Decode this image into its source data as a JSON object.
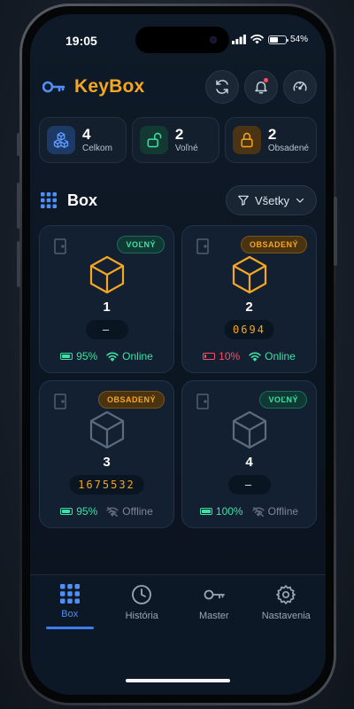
{
  "status_bar": {
    "time": "19:05",
    "battery": "54%",
    "battery_level": 0.54
  },
  "header": {
    "title": "KeyBox",
    "buttons": [
      "refresh-icon",
      "bell-icon",
      "gauge-icon"
    ],
    "has_notification": true
  },
  "stats": [
    {
      "value": "4",
      "label": "Celkom",
      "icon": "cubes-icon",
      "color": "#4f8ff7"
    },
    {
      "value": "2",
      "label": "Voľné",
      "icon": "unlock-icon",
      "color": "#3de0a6"
    },
    {
      "value": "2",
      "label": "Obsadené",
      "icon": "lock-icon",
      "color": "#f5a623"
    }
  ],
  "section": {
    "title": "Box",
    "filter_label": "Všetky"
  },
  "boxes": [
    {
      "number": "1",
      "status": "VOĽNÝ",
      "code": "—",
      "battery": "95%",
      "connection": "Online"
    },
    {
      "number": "2",
      "status": "OBSADENÝ",
      "code": "0694",
      "battery": "10%",
      "connection": "Online"
    },
    {
      "number": "3",
      "status": "OBSADENÝ",
      "code": "1675532",
      "battery": "95%",
      "connection": "Offline"
    },
    {
      "number": "4",
      "status": "VOĽNÝ",
      "code": "—",
      "battery": "100%",
      "connection": "Offline"
    }
  ],
  "tabs": [
    {
      "label": "Box",
      "icon": "grid-icon",
      "active": true
    },
    {
      "label": "História",
      "icon": "clock-icon",
      "active": false
    },
    {
      "label": "Master",
      "icon": "key-icon",
      "active": false
    },
    {
      "label": "Nastavenia",
      "icon": "gear-icon",
      "active": false
    }
  ],
  "colors": {
    "accent": "#f5a623",
    "primary": "#4f8ff7",
    "free": "#3de0a6",
    "low_battery": "#ff4d5e",
    "offline": "#7d8797"
  }
}
